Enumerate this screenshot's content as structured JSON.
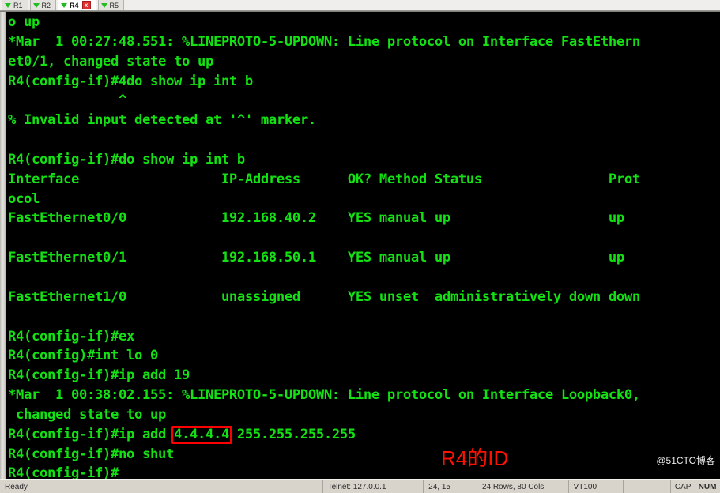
{
  "window": {
    "tabs": [
      {
        "label": "R1",
        "active": false,
        "closable": false,
        "icon": "green-down-arrow-icon"
      },
      {
        "label": "R2",
        "active": false,
        "closable": false,
        "icon": "green-down-arrow-icon"
      },
      {
        "label": "R4",
        "active": true,
        "closable": true,
        "icon": "green-down-arrow-icon",
        "close_label": "x"
      },
      {
        "label": "R5",
        "active": false,
        "closable": false,
        "icon": "green-down-arrow-icon"
      }
    ]
  },
  "terminal": {
    "foreground_color": "#13e113",
    "background_color": "#000000",
    "lines": [
      "o up",
      "*Mar  1 00:27:48.551: %LINEPROTO-5-UPDOWN: Line protocol on Interface FastEthern",
      "et0/1, changed state to up",
      "R4(config-if)#4do show ip int b",
      "              ^",
      "% Invalid input detected at '^' marker.",
      "",
      "R4(config-if)#do show ip int b",
      "Interface                  IP-Address      OK? Method Status                Prot",
      "ocol",
      "FastEthernet0/0            192.168.40.2    YES manual up                    up",
      "",
      "FastEthernet0/1            192.168.50.1    YES manual up                    up",
      "",
      "FastEthernet1/0            unassigned      YES unset  administratively down down",
      "",
      "R4(config-if)#ex",
      "R4(config)#int lo 0",
      "R4(config-if)#ip add 19",
      "*Mar  1 00:38:02.155: %LINEPROTO-5-UPDOWN: Line protocol on Interface Loopback0,",
      " changed state to up",
      "R4(config-if)#ip add 4.4.4.4 255.255.255.255",
      "R4(config-if)#no shut",
      "R4(config-if)#"
    ]
  },
  "annotations": {
    "highlight_color": "#ff0000",
    "highlight_target": "4.4.4.4",
    "label": "R4的ID",
    "label_color": "#ff1100"
  },
  "watermark": {
    "text": "@51CTO博客"
  },
  "statusbar": {
    "ready": "Ready",
    "connection": "Telnet: 127.0.0.1",
    "cursor_position": "24, 15",
    "dimensions": "24 Rows, 80 Cols",
    "emulation": "VT100",
    "blank": "",
    "caps_indicator": "CAP",
    "num_indicator": "NUM"
  }
}
